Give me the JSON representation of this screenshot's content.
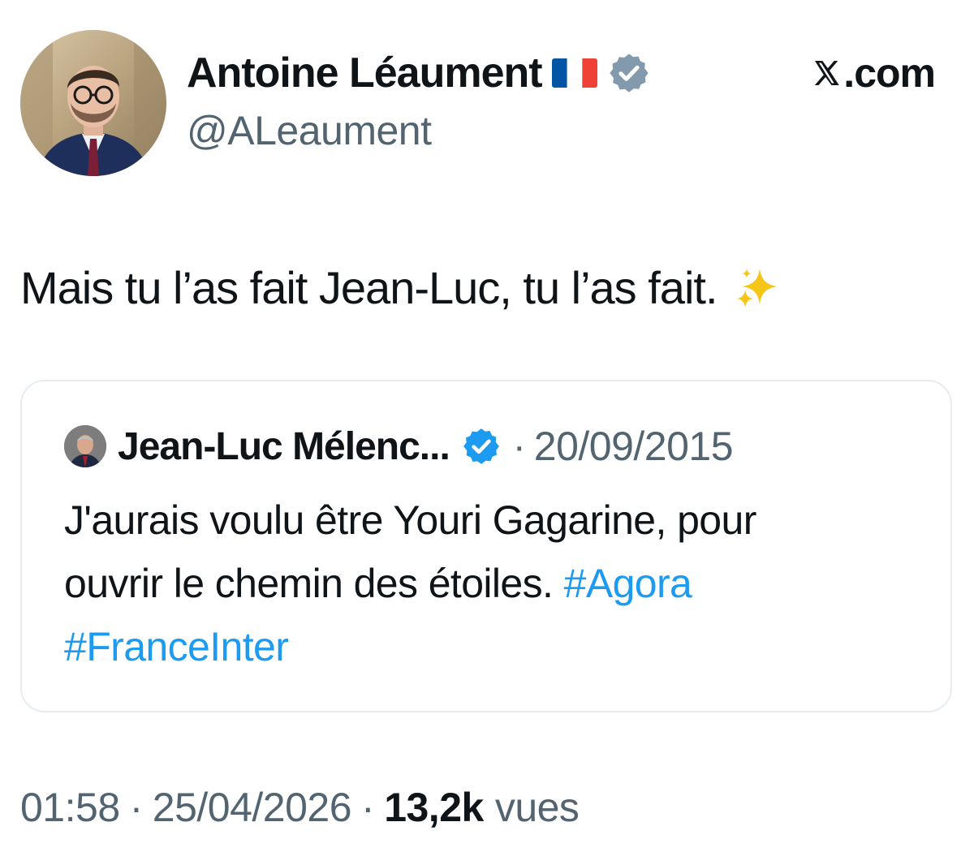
{
  "author": {
    "display_name": "Antoine Léaument",
    "handle": "@ALeaument",
    "flag_icon": "france-flag-icon",
    "badge_icon": "gray-verified-badge-icon",
    "avatar_icon": "profile-photo"
  },
  "brand": {
    "logo_icon": "x-logo-icon",
    "suffix": ".com"
  },
  "tweet": {
    "text": "Mais tu l’as fait Jean-Luc, tu l’as fait.",
    "emoji_icon": "sparkles-icon"
  },
  "quote": {
    "author": "Jean-Luc Mélenc...",
    "badge_icon": "blue-verified-badge-icon",
    "separator": "·",
    "date": "20/09/2015",
    "line1": "J'aurais voulu être Youri Gagarine, pour",
    "line2_text": "ouvrir le chemin des étoiles. ",
    "hashtag1": "#Agora",
    "hashtag2": "#FranceInter"
  },
  "meta": {
    "time": "01:58",
    "separator": "·",
    "date": "25/04/2026",
    "views_count": "13,2k",
    "views_label": "vues"
  },
  "colors": {
    "text_primary": "#0f1419",
    "text_secondary": "#536471",
    "link": "#1d9bf0",
    "verified_blue": "#1d9bf0",
    "verified_gray": "#829aab",
    "card_border": "#e6ecf0"
  }
}
